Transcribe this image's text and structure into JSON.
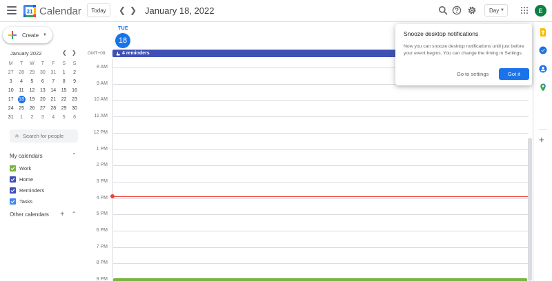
{
  "header": {
    "app_title": "Calendar",
    "today_label": "Today",
    "date_title": "January 18, 2022",
    "view_label": "Day",
    "avatar_initial": "E"
  },
  "create": {
    "label": "Create"
  },
  "mini_calendar": {
    "month_label": "January 2022",
    "weekdays": [
      "M",
      "T",
      "W",
      "T",
      "F",
      "S",
      "S"
    ],
    "weeks": [
      [
        "27",
        "28",
        "29",
        "30",
        "31",
        "1",
        "2"
      ],
      [
        "3",
        "4",
        "5",
        "6",
        "7",
        "8",
        "9"
      ],
      [
        "10",
        "11",
        "12",
        "13",
        "14",
        "15",
        "16"
      ],
      [
        "17",
        "18",
        "19",
        "20",
        "21",
        "22",
        "23"
      ],
      [
        "24",
        "25",
        "26",
        "27",
        "28",
        "29",
        "30"
      ],
      [
        "31",
        "1",
        "2",
        "3",
        "4",
        "5",
        "6"
      ]
    ],
    "selected": "18"
  },
  "search_people": {
    "placeholder": "Search for people"
  },
  "my_calendars": {
    "title": "My calendars",
    "items": [
      {
        "label": "Work",
        "color": "#7cb342"
      },
      {
        "label": "Home",
        "color": "#3f51b5"
      },
      {
        "label": "Reminders",
        "color": "#3f51b5"
      },
      {
        "label": "Tasks",
        "color": "#4285f4"
      }
    ]
  },
  "other_calendars": {
    "title": "Other calendars"
  },
  "day_view": {
    "weekday": "TUE",
    "day_number": "18",
    "timezone": "GMT+08",
    "reminders_label": "4 reminders",
    "hours": [
      "8 AM",
      "9 AM",
      "10 AM",
      "11 AM",
      "12 PM",
      "1 PM",
      "2 PM",
      "3 PM",
      "4 PM",
      "5 PM",
      "6 PM",
      "7 PM",
      "8 PM",
      "9 PM"
    ]
  },
  "popup": {
    "title": "Snooze desktop notifications",
    "body": "Now you can snooze desktop notifications until just before your event begins. You can change the timing in Settings.",
    "settings_label": "Go to settings",
    "gotit_label": "Got it"
  },
  "colors": {
    "accent": "#1a73e8",
    "reminders": "#3f51b5",
    "now_line": "#ea4335",
    "work": "#7cb342",
    "avatar": "#0b8043"
  }
}
